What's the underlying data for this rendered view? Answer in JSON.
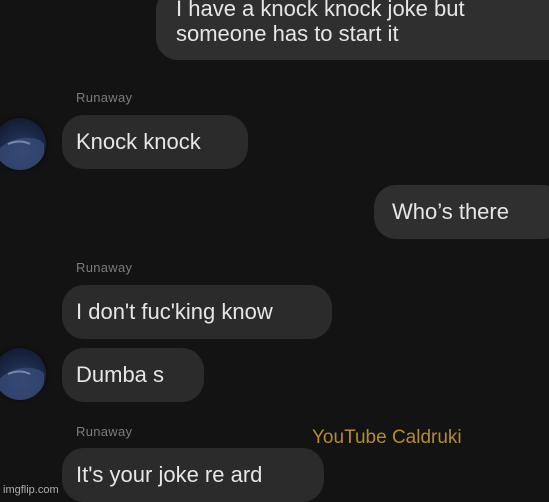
{
  "conversation": {
    "messages": [
      {
        "direction": "outgoing",
        "lines": [
          "I have a knock knock joke but",
          "someone has to start it"
        ]
      },
      {
        "direction": "incoming",
        "sender": "Runaway",
        "text": "Knock knock"
      },
      {
        "direction": "outgoing",
        "text": "Who’s there"
      },
      {
        "direction": "incoming",
        "sender": "Runaway",
        "text": "I don't fuc'king know"
      },
      {
        "direction": "incoming",
        "text": "Dumba s"
      },
      {
        "direction": "incoming",
        "sender": "Runaway",
        "text": "It's your joke re ard"
      }
    ]
  },
  "overlays": {
    "watermark": "YouTube Caldruki",
    "footer": "imgflip.com"
  },
  "colors": {
    "background": "#131313",
    "bubble": "#2b2b2b",
    "text": "#e6e6e6",
    "sender": "#7b7b7b",
    "watermark": "#b08d35"
  }
}
